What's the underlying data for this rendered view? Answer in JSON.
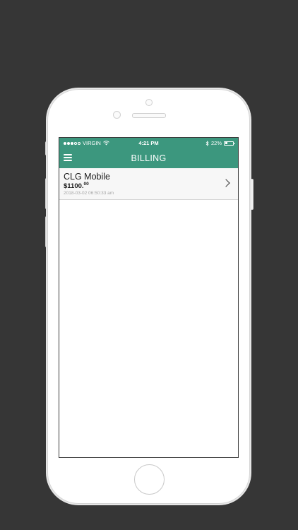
{
  "status_bar": {
    "carrier": "VIRGIN",
    "time": "4:21 PM",
    "battery": "22%",
    "battery_level": 0.22,
    "signal_bars": 3,
    "signal_total": 5
  },
  "nav": {
    "title": "BILLING"
  },
  "bills": [
    {
      "name": "CLG Mobile",
      "amount": "$1100.",
      "amount_cents": "00",
      "date": "2018-03-02 06:50:33 am"
    }
  ],
  "colors": {
    "accent": "#3c977e",
    "background": "#363636"
  },
  "icons": {
    "menu": "hamburger-menu-icon",
    "wifi": "wifi-icon",
    "bluetooth": "bluetooth-icon",
    "battery": "battery-icon",
    "disclosure": "chevron-right-icon"
  }
}
